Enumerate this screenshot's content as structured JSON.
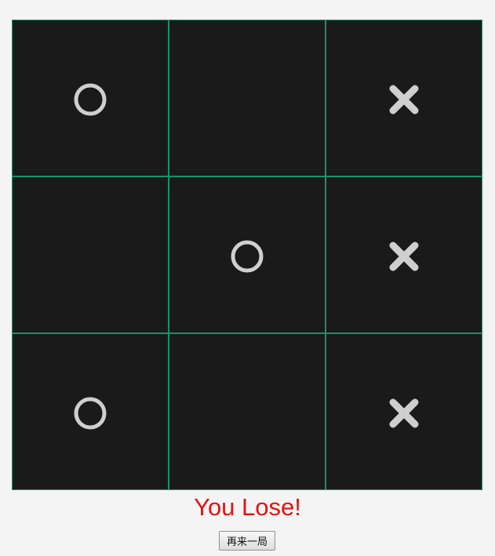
{
  "board": {
    "cells": [
      "O",
      "",
      "X",
      "",
      "O",
      "X",
      "O",
      "",
      "X"
    ]
  },
  "result_text": "You Lose!",
  "restart_label": "再来一局",
  "colors": {
    "background": "#f4f4f4",
    "board": "#1a1a1a",
    "grid_line": "#17926b",
    "mark": "#cfcfcf",
    "result": "#e51212"
  }
}
